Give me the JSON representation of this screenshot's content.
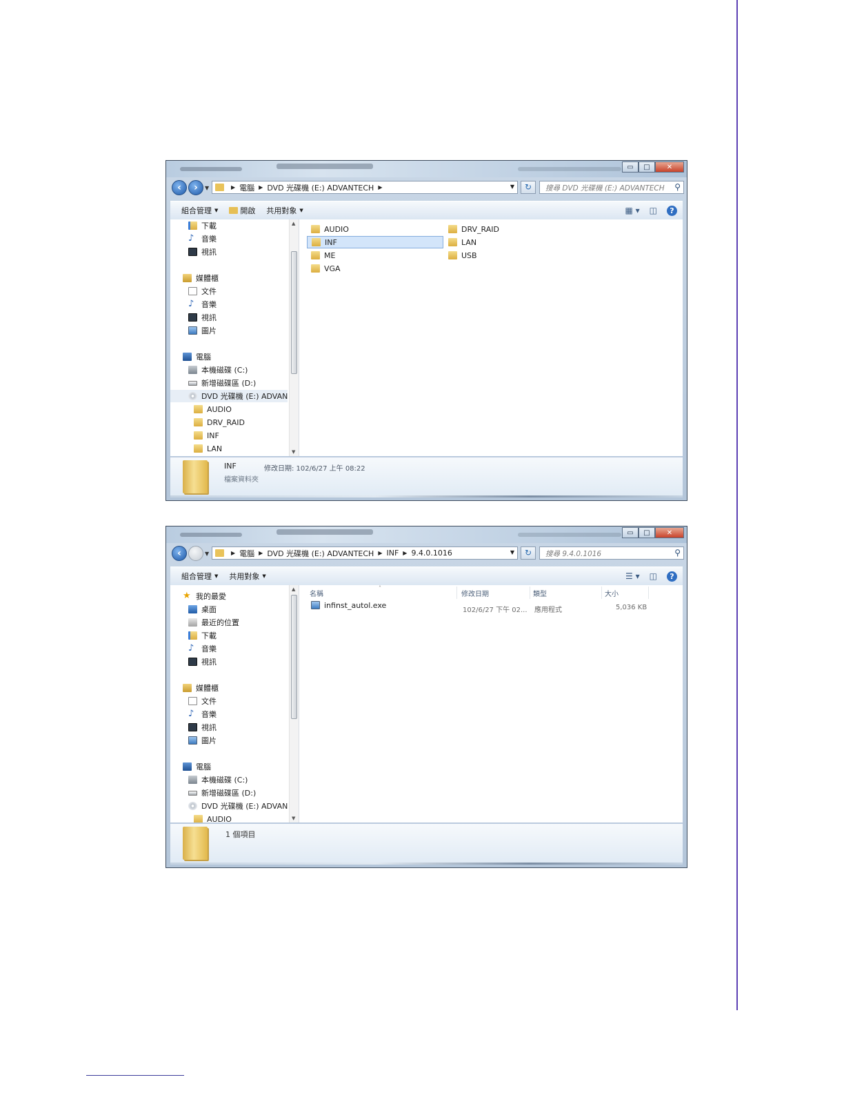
{
  "window1": {
    "caption_buttons": [
      "▭",
      "□",
      "✕"
    ],
    "address": {
      "back": "‹",
      "forward": "›",
      "crumbs": [
        "電腦",
        "DVD 光碟機 (E:) ADVANTECH"
      ],
      "refresh": "↻",
      "search_placeholder": "搜尋 DVD 光碟機 (E:) ADVANTECH"
    },
    "toolbar": {
      "organize": "組合管理",
      "open": "開啟",
      "share": "共用對象"
    },
    "nav": {
      "items": [
        "下載",
        "音樂",
        "視訊"
      ],
      "libraries": "媒體櫃",
      "library_items": [
        "文件",
        "音樂",
        "視訊",
        "圖片"
      ],
      "computer": "電腦",
      "drives": [
        "本機磁碟 (C:)",
        "新增磁碟區 (D:)",
        "DVD 光碟機 (E:) ADVANTECH"
      ],
      "subfolders": [
        "AUDIO",
        "DRV_RAID",
        "INF",
        "LAN"
      ]
    },
    "folders": [
      "AUDIO",
      "DRV_RAID",
      "INF",
      "LAN",
      "ME",
      "USB",
      "VGA"
    ],
    "details": {
      "name": "INF",
      "type": "檔案資料夾",
      "modified": "修改日期: 102/6/27 上午 08:22"
    }
  },
  "window2": {
    "caption_buttons": [
      "▭",
      "□",
      "✕"
    ],
    "address": {
      "back": "‹",
      "crumbs": [
        "電腦",
        "DVD 光碟機 (E:) ADVANTECH",
        "INF",
        "9.4.0.1016"
      ],
      "refresh": "↻",
      "search_placeholder": "搜尋 9.4.0.1016"
    },
    "toolbar": {
      "organize": "組合管理",
      "share": "共用對象"
    },
    "nav": {
      "favorites": "我的最愛",
      "favorite_items": [
        "桌面",
        "最近的位置",
        "下載",
        "音樂",
        "視訊"
      ],
      "libraries": "媒體櫃",
      "library_items": [
        "文件",
        "音樂",
        "視訊",
        "圖片"
      ],
      "computer": "電腦",
      "drives": [
        "本機磁碟 (C:)",
        "新增磁碟區 (D:)",
        "DVD 光碟機 (E:) ADVANTECH"
      ],
      "subfolders": [
        "AUDIO"
      ]
    },
    "columns": {
      "name": "名稱",
      "date": "修改日期",
      "type": "類型",
      "size": "大小"
    },
    "file": {
      "name": "infinst_autol.exe",
      "date": "102/6/27 下午 02...",
      "type": "應用程式",
      "size": "5,036 KB"
    },
    "details": {
      "count": "1 個項目"
    }
  },
  "colors": {
    "accent_rule": "#5b3fb4",
    "selection": "#d3e5fa",
    "folder": "#e6bf55"
  }
}
